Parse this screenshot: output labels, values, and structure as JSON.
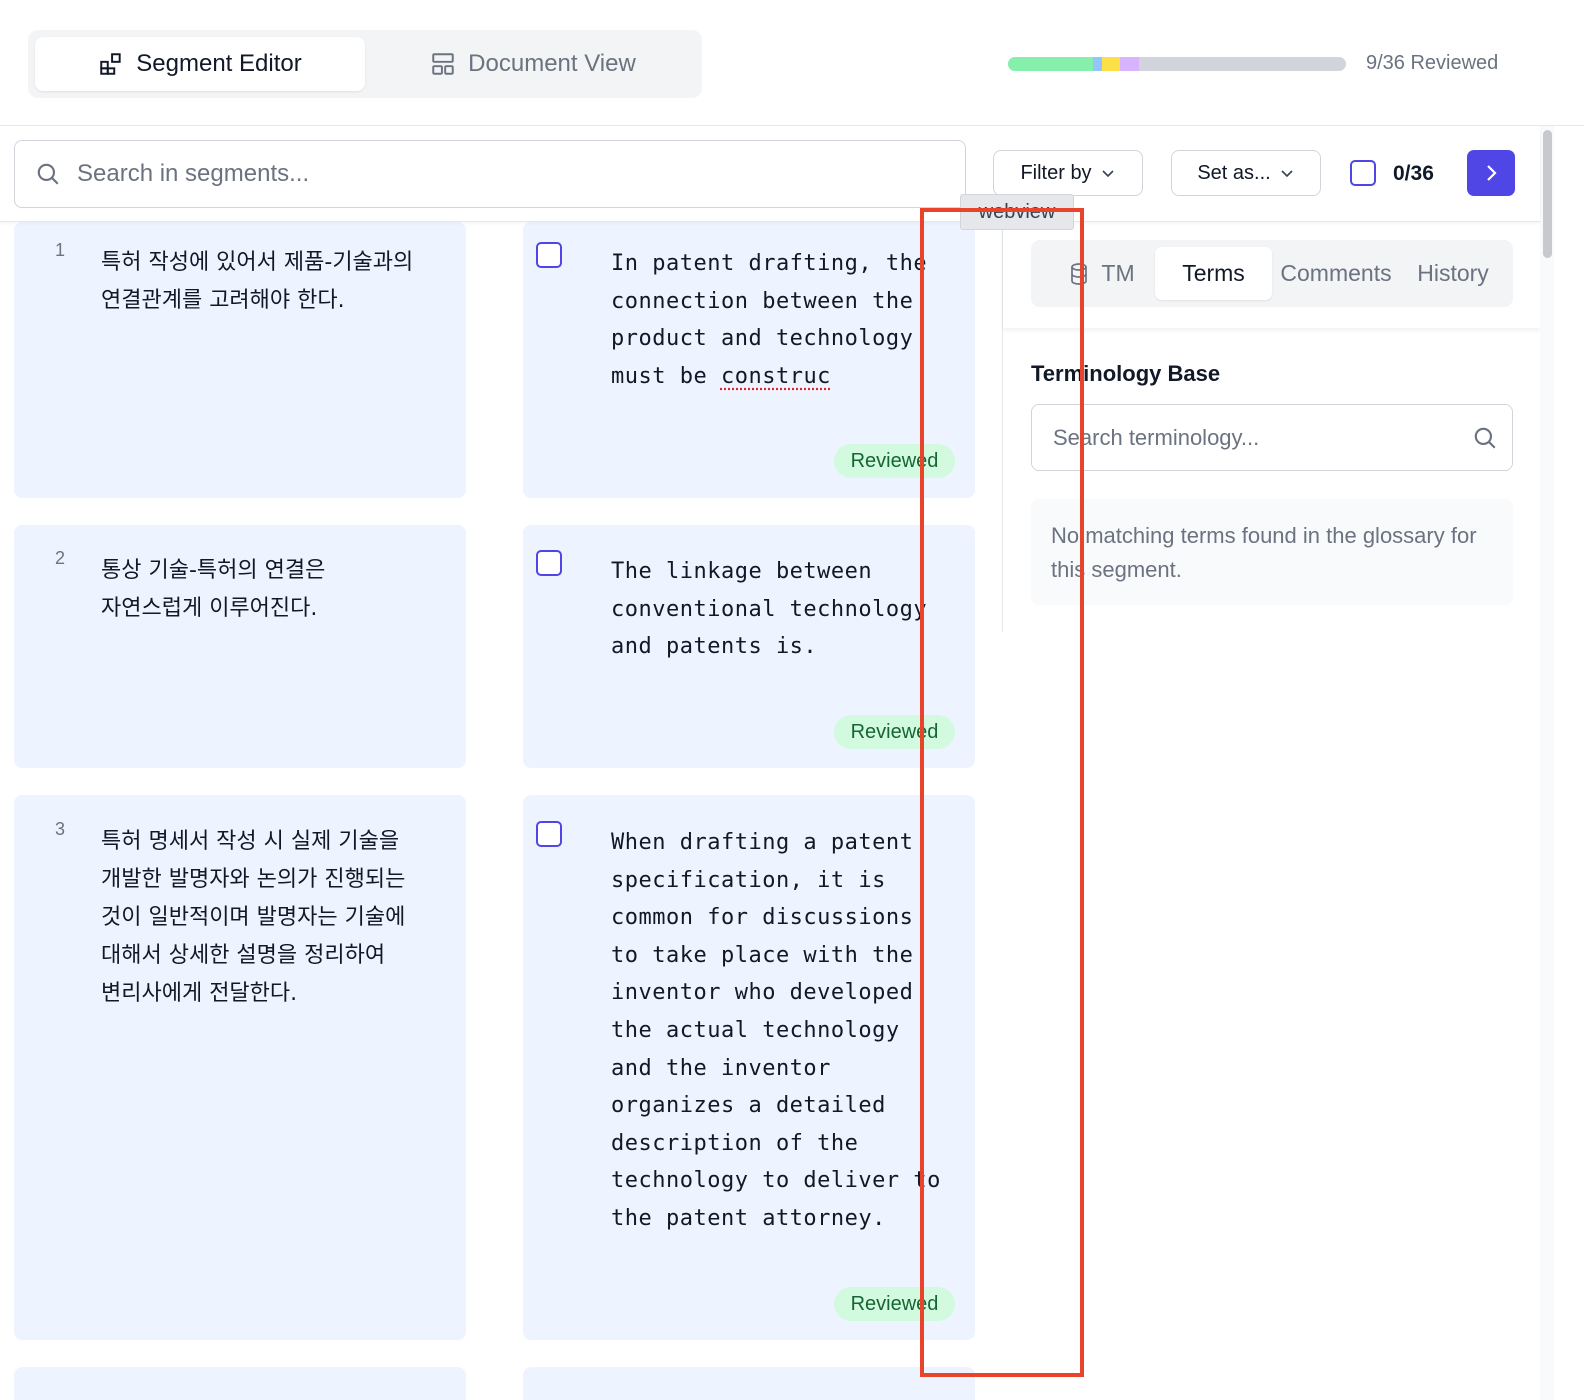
{
  "header": {
    "tabs": [
      {
        "label": "Segment Editor",
        "icon": "segment-editor-icon",
        "active": true
      },
      {
        "label": "Document View",
        "icon": "document-view-icon",
        "active": false
      }
    ],
    "progress": {
      "label": "9/36 Reviewed",
      "reviewed": 9,
      "total": 36,
      "segments": [
        {
          "status": "reviewed",
          "color": "#86efac",
          "fraction": 0.25
        },
        {
          "status": "segment-2",
          "color": "#93c5fd",
          "fraction": 0.027
        },
        {
          "status": "segment-3",
          "color": "#fde047",
          "fraction": 0.055
        },
        {
          "status": "segment-4",
          "color": "#d8b4fe",
          "fraction": 0.055
        }
      ]
    }
  },
  "toolbar": {
    "search_placeholder": "Search in segments...",
    "filter_label": "Filter by",
    "set_as_label": "Set as...",
    "selection_count": "0/36",
    "accent_color": "#4f46e5"
  },
  "segments": [
    {
      "number": "1",
      "source": "특허 작성에 있어서 제품-기술과의 연결관계를 고려해야 한다.",
      "target_main": "In patent drafting, the connection between the product and technology must be ",
      "target_flagged": "construc",
      "status": "Reviewed"
    },
    {
      "number": "2",
      "source": "통상 기술-특허의 연결은 자연스럽게 이루어진다.",
      "target_main": "The linkage between conventional technology and patents is.",
      "target_flagged": "",
      "status": "Reviewed"
    },
    {
      "number": "3",
      "source": "특허 명세서 작성 시 실제 기술을 개발한 발명자와 논의가 진행되는 것이 일반적이며 발명자는 기술에 대해서 상세한 설명을 정리하여 변리사에게 전달한다.",
      "target_main": "When drafting a patent specification, it is common for discussions to take place with the inventor who developed the actual technology and the inventor organizes a detailed description of the technology to deliver to the patent attorney.",
      "target_flagged": "",
      "status": "Reviewed"
    }
  ],
  "side_panel": {
    "tabs": [
      {
        "label": "TM",
        "icon": "database-icon",
        "active": false
      },
      {
        "label": "Terms",
        "active": true
      },
      {
        "label": "Comments",
        "active": false
      },
      {
        "label": "History",
        "active": false
      }
    ],
    "heading": "Terminology Base",
    "search_placeholder": "Search terminology...",
    "empty_message": "No matching terms found in the glossary for this segment."
  },
  "overlay": {
    "tooltip": "webview",
    "highlight_color": "#e8442c"
  }
}
